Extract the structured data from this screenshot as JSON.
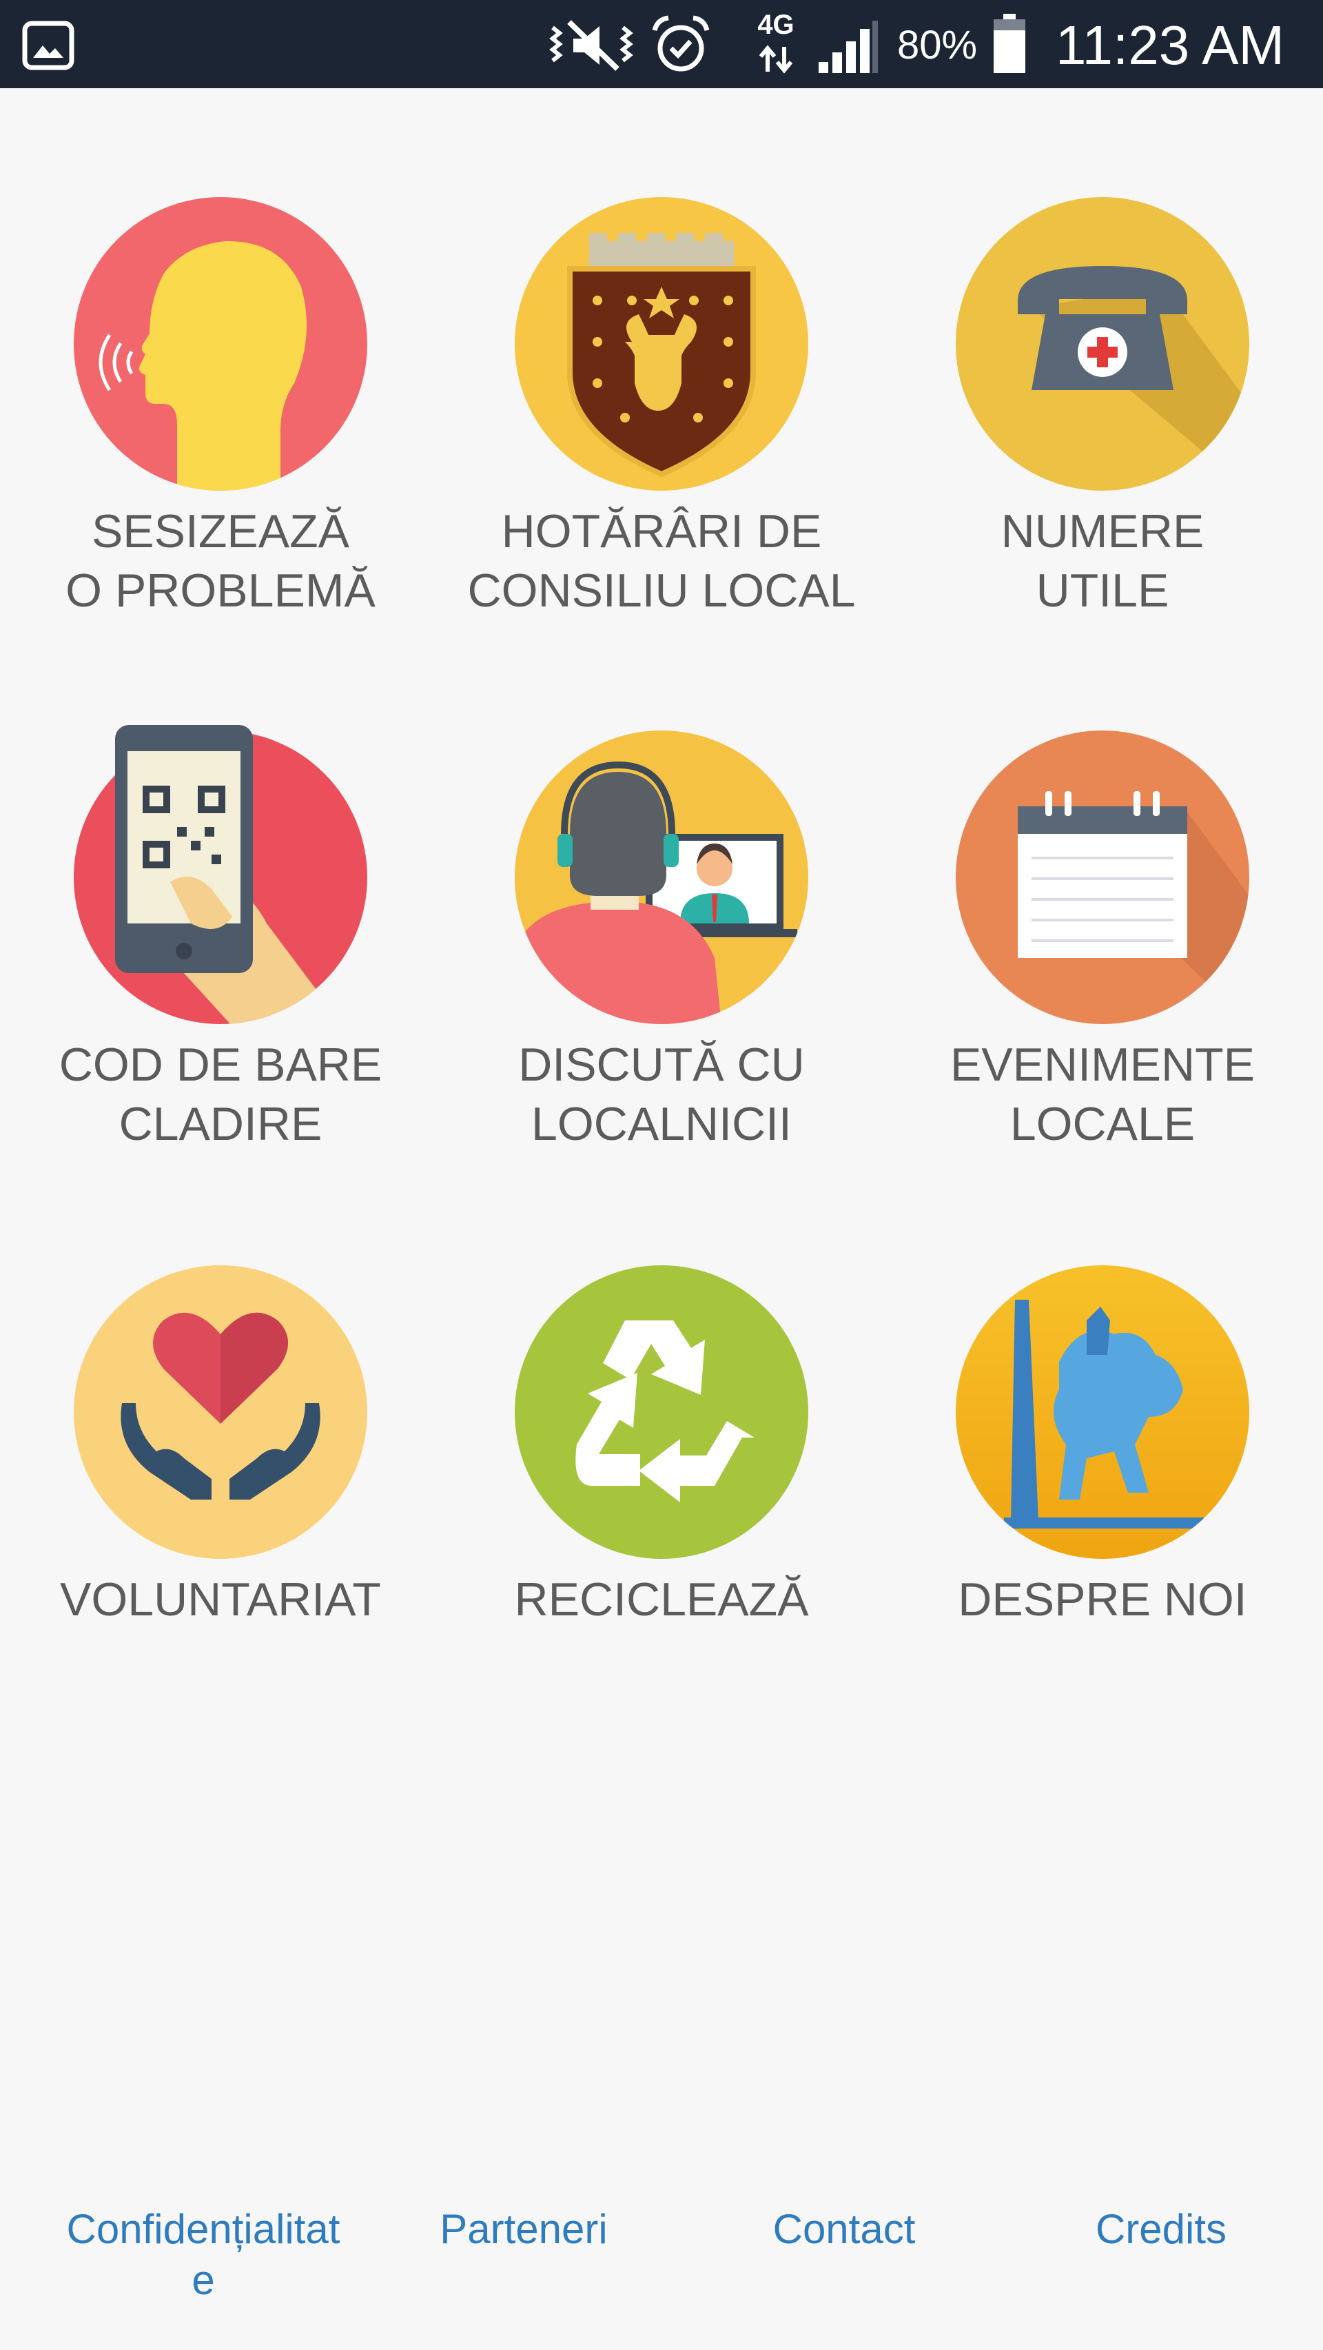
{
  "status_bar": {
    "battery_percent": "80%",
    "time": "11:23 AM",
    "network": "4G",
    "icons": [
      "gallery-icon",
      "mute-vibrate-icon",
      "alarm-icon",
      "network-4g-icon",
      "signal-icon",
      "battery-icon"
    ]
  },
  "tiles": [
    {
      "id": "sesizeaza",
      "icon": "speaking-head-icon",
      "lines": [
        "SESIZEAZĂ",
        "O PROBLEMĂ"
      ],
      "bg": "#f2676b"
    },
    {
      "id": "hotarari",
      "icon": "city-coat-of-arms-icon",
      "lines": [
        "HOTĂRÂRI DE",
        "CONSILIU LOCAL"
      ],
      "bg": "#f8c645"
    },
    {
      "id": "numere",
      "icon": "emergency-phone-icon",
      "lines": [
        "NUMERE",
        "UTILE"
      ],
      "bg": "#ecc144"
    },
    {
      "id": "cod",
      "icon": "qr-code-phone-icon",
      "lines": [
        "COD DE BARE",
        "CLADIRE"
      ],
      "bg": "#ea4f5b"
    },
    {
      "id": "discuta",
      "icon": "video-chat-icon",
      "lines": [
        "DISCUTĂ CU",
        "LOCALNICII"
      ],
      "bg": "#f6c244"
    },
    {
      "id": "evenimente",
      "icon": "calendar-icon",
      "lines": [
        "EVENIMENTE",
        "LOCALE"
      ],
      "bg": "#e88654"
    },
    {
      "id": "voluntariat",
      "icon": "heart-hands-icon",
      "lines": [
        "VOLUNTARIAT"
      ],
      "bg": "#fbd27c"
    },
    {
      "id": "recicleaza",
      "icon": "recycle-icon",
      "lines": [
        "RECICLEAZĂ"
      ],
      "bg": "#a6c43c"
    },
    {
      "id": "despre",
      "icon": "equestrian-statue-icon",
      "lines": [
        "DESPRE NOI"
      ],
      "bg": "#f5b31e"
    }
  ],
  "footer": {
    "confidentialitate_line1": "Confidențialitat",
    "confidentialitate_line2": "e",
    "parteneri": "Parteneri",
    "contact": "Contact",
    "credits": "Credits",
    "link_color": "#2e7bbd"
  }
}
